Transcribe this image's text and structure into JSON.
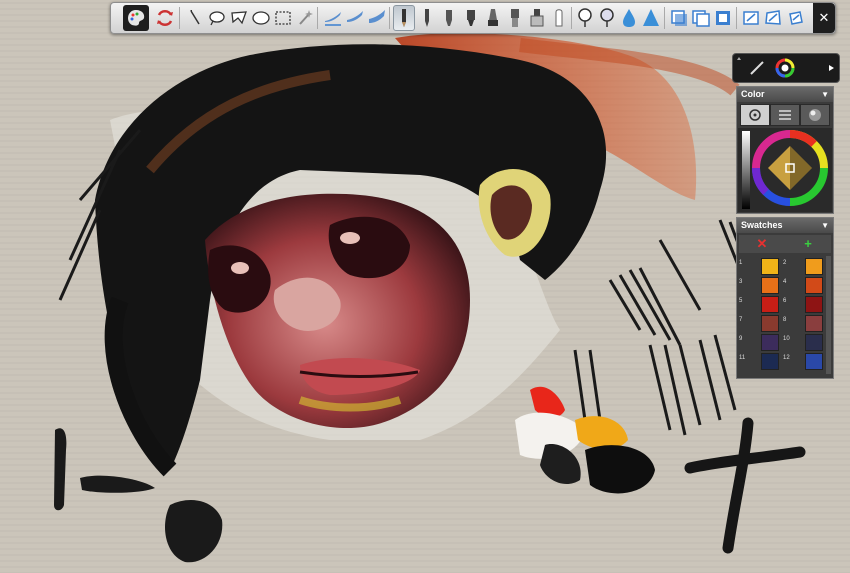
{
  "toolbar": {
    "close_label": "✕",
    "tools": [
      {
        "name": "palette-icon"
      },
      {
        "name": "swap-colors-icon"
      },
      {
        "name": "lasso-pen-icon"
      },
      {
        "name": "lasso-freehand-icon"
      },
      {
        "name": "lasso-polygon-icon"
      },
      {
        "name": "ellipse-select-icon"
      },
      {
        "name": "rect-select-icon"
      },
      {
        "name": "magic-wand-icon"
      },
      {
        "name": "brush-small-icon"
      },
      {
        "name": "brush-medium-icon"
      },
      {
        "name": "brush-large-icon"
      },
      {
        "name": "pencil-icon"
      },
      {
        "name": "ink-pen-icon"
      },
      {
        "name": "marker-icon"
      },
      {
        "name": "technical-pen-icon"
      },
      {
        "name": "airbrush-icon"
      },
      {
        "name": "paint-roller-icon"
      },
      {
        "name": "eraser-icon"
      },
      {
        "name": "chalk-icon"
      },
      {
        "name": "smudge-icon"
      },
      {
        "name": "blur-icon"
      },
      {
        "name": "water-drop-icon"
      },
      {
        "name": "triangle-fill-icon"
      },
      {
        "name": "layer-move-icon"
      },
      {
        "name": "layer-copy-icon"
      },
      {
        "name": "layer-edit-icon"
      },
      {
        "name": "transform-scale-icon"
      },
      {
        "name": "transform-distort-icon"
      },
      {
        "name": "transform-rotate-icon"
      }
    ]
  },
  "color_panel": {
    "title": "Color",
    "chevron": "▼"
  },
  "swatches_panel": {
    "title": "Swatches",
    "chevron": "▼",
    "remove_label": "✕",
    "add_label": "+",
    "rows": [
      {
        "left_num": "1",
        "left_color": "#f0b418",
        "right_num": "2",
        "right_color": "#f09c1c"
      },
      {
        "left_num": "3",
        "left_color": "#e87018",
        "right_num": "4",
        "right_color": "#d24a18"
      },
      {
        "left_num": "5",
        "left_color": "#c81e16",
        "right_num": "6",
        "right_color": "#8e1414"
      },
      {
        "left_num": "7",
        "left_color": "#8a3a2e",
        "right_num": "8",
        "right_color": "#8a3e3e"
      },
      {
        "left_num": "9",
        "left_color": "#3c2c5c",
        "right_num": "10",
        "right_color": "#2a2e4c"
      },
      {
        "left_num": "11",
        "left_color": "#1c2a52",
        "right_num": "12",
        "right_color": "#2a48a8"
      }
    ]
  }
}
